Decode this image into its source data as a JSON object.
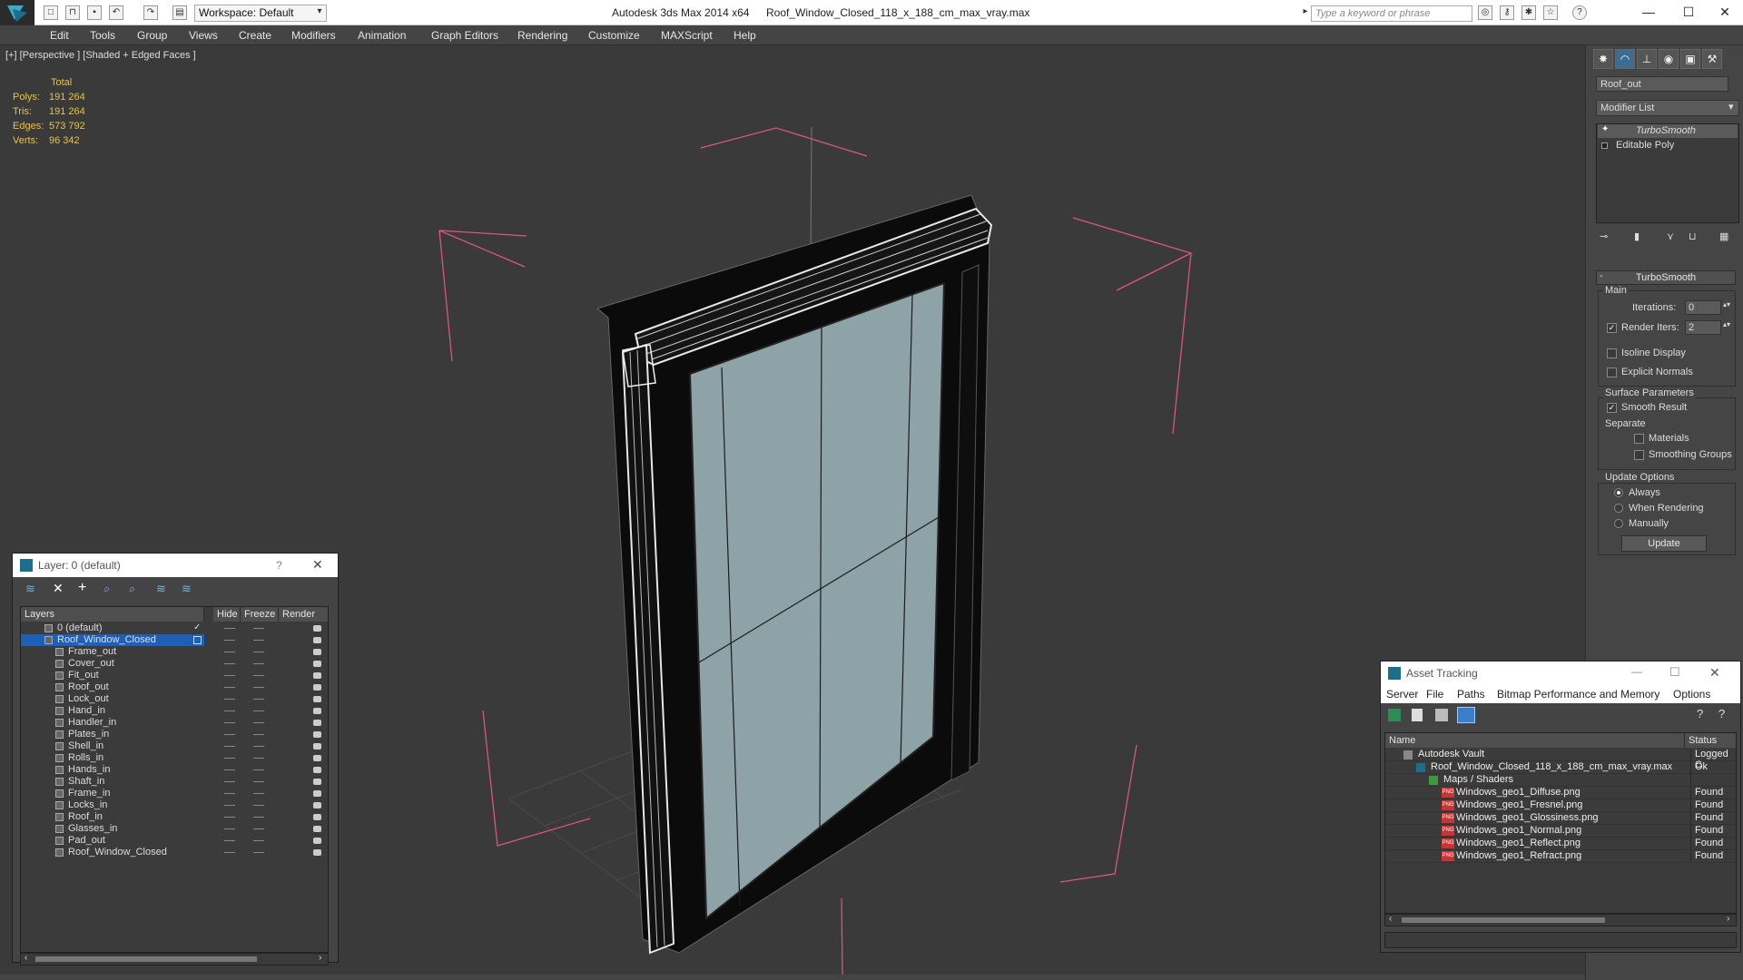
{
  "app": {
    "title": "Autodesk 3ds Max  2014 x64",
    "file": "Roof_Window_Closed_118_x_188_cm_max_vray.max",
    "workspace": "Workspace: Default",
    "search_placeholder": "Type a keyword or phrase",
    "help": "?"
  },
  "menu": [
    "Edit",
    "Tools",
    "Group",
    "Views",
    "Create",
    "Modifiers",
    "Animation",
    "Graph Editors",
    "Rendering",
    "Customize",
    "MAXScript",
    "Help"
  ],
  "viewport": {
    "label": "[+] [Perspective ] [Shaded + Edged Faces ]",
    "stats_header": "Total",
    "stats": [
      {
        "label": "Polys:",
        "value": "191 264"
      },
      {
        "label": "Tris:",
        "value": "191 264"
      },
      {
        "label": "Edges:",
        "value": "573 792"
      },
      {
        "label": "Verts:",
        "value": "96 342"
      }
    ]
  },
  "command_panel": {
    "object_name": "Roof_out",
    "modifier_list": "Modifier List",
    "stack": [
      "TurboSmooth",
      "Editable Poly"
    ],
    "rollout": "TurboSmooth",
    "main_label": "Main",
    "iterations_label": "Iterations:",
    "iterations": "0",
    "render_iters_label": "Render Iters:",
    "render_iters": "2",
    "isoline": "Isoline Display",
    "explicit_normals": "Explicit Normals",
    "surface_params": "Surface Parameters",
    "smooth_result": "Smooth Result",
    "separate": "Separate",
    "materials": "Materials",
    "smoothing_groups": "Smoothing Groups",
    "update_options": "Update Options",
    "always": "Always",
    "when_rendering": "When Rendering",
    "manually": "Manually",
    "update_button": "Update"
  },
  "layer_window": {
    "title": "Layer: 0 (default)",
    "help": "?",
    "columns": [
      "Layers",
      "Hide",
      "Freeze",
      "Render"
    ],
    "rows": [
      "0 (default)",
      "Roof_Window_Closed",
      "Frame_out",
      "Cover_out",
      "Fit_out",
      "Roof_out",
      "Lock_out",
      "Hand_in",
      "Handler_in",
      "Plates_in",
      "Shell_in",
      "Rolls_in",
      "Hands_in",
      "Shaft_in",
      "Frame_in",
      "Locks_in",
      "Roof_in",
      "Glasses_in",
      "Pad_out",
      "Roof_Window_Closed"
    ]
  },
  "asset_tracking": {
    "title": "Asset Tracking",
    "menu": [
      "Server",
      "File",
      "Paths",
      "Bitmap Performance and Memory",
      "Options"
    ],
    "columns": [
      "Name",
      "Status"
    ],
    "rows": [
      {
        "name": "Autodesk Vault",
        "status": "Logged C"
      },
      {
        "name": "Roof_Window_Closed_118_x_188_cm_max_vray.max",
        "status": "Ok"
      },
      {
        "name": "Maps / Shaders",
        "status": ""
      },
      {
        "name": "Windows_geo1_Diffuse.png",
        "status": "Found"
      },
      {
        "name": "Windows_geo1_Fresnel.png",
        "status": "Found"
      },
      {
        "name": "Windows_geo1_Glossiness.png",
        "status": "Found"
      },
      {
        "name": "Windows_geo1_Normal.png",
        "status": "Found"
      },
      {
        "name": "Windows_geo1_Reflect.png",
        "status": "Found"
      },
      {
        "name": "Windows_geo1_Refract.png",
        "status": "Found"
      }
    ]
  },
  "colors": {
    "selection": "#1f5fb5",
    "stats": "#e8c24a",
    "bbox": "#d9567d",
    "glass": "#8ea3a7"
  }
}
